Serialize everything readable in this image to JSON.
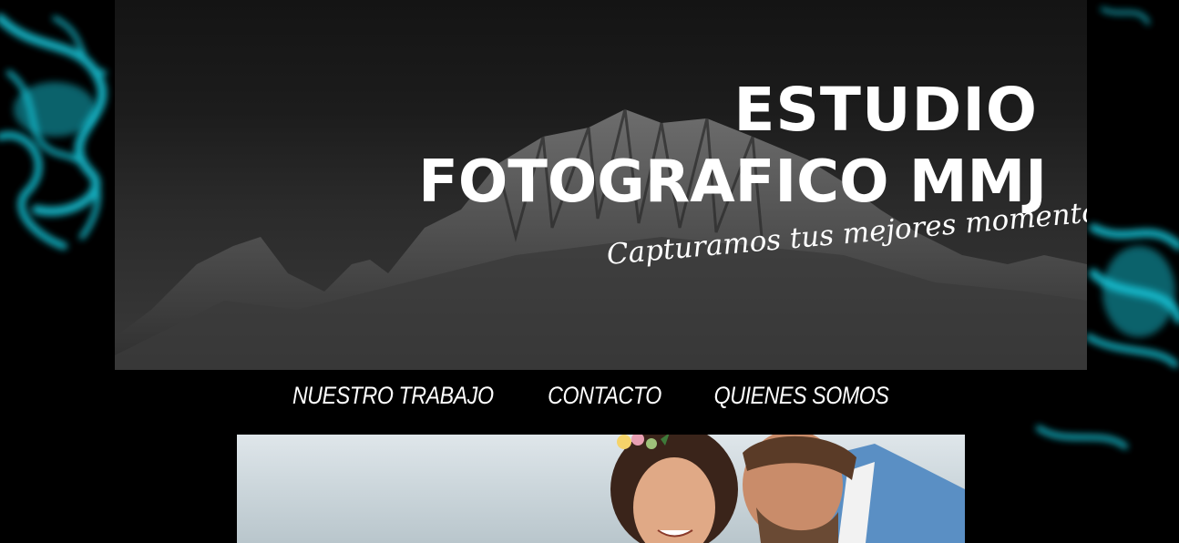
{
  "hero": {
    "title_line1": "ESTUDIO",
    "title_line2": "FOTOGRAFICO MMJ",
    "tagline": "Capturamos tus mejores momentos"
  },
  "nav": {
    "items": [
      {
        "label": "NUESTRO TRABAJO"
      },
      {
        "label": "CONTACTO"
      },
      {
        "label": "QUIENES SOMOS"
      }
    ]
  },
  "colors": {
    "background": "#000000",
    "smoke_accent": "#19c3d6",
    "text": "#ffffff"
  }
}
